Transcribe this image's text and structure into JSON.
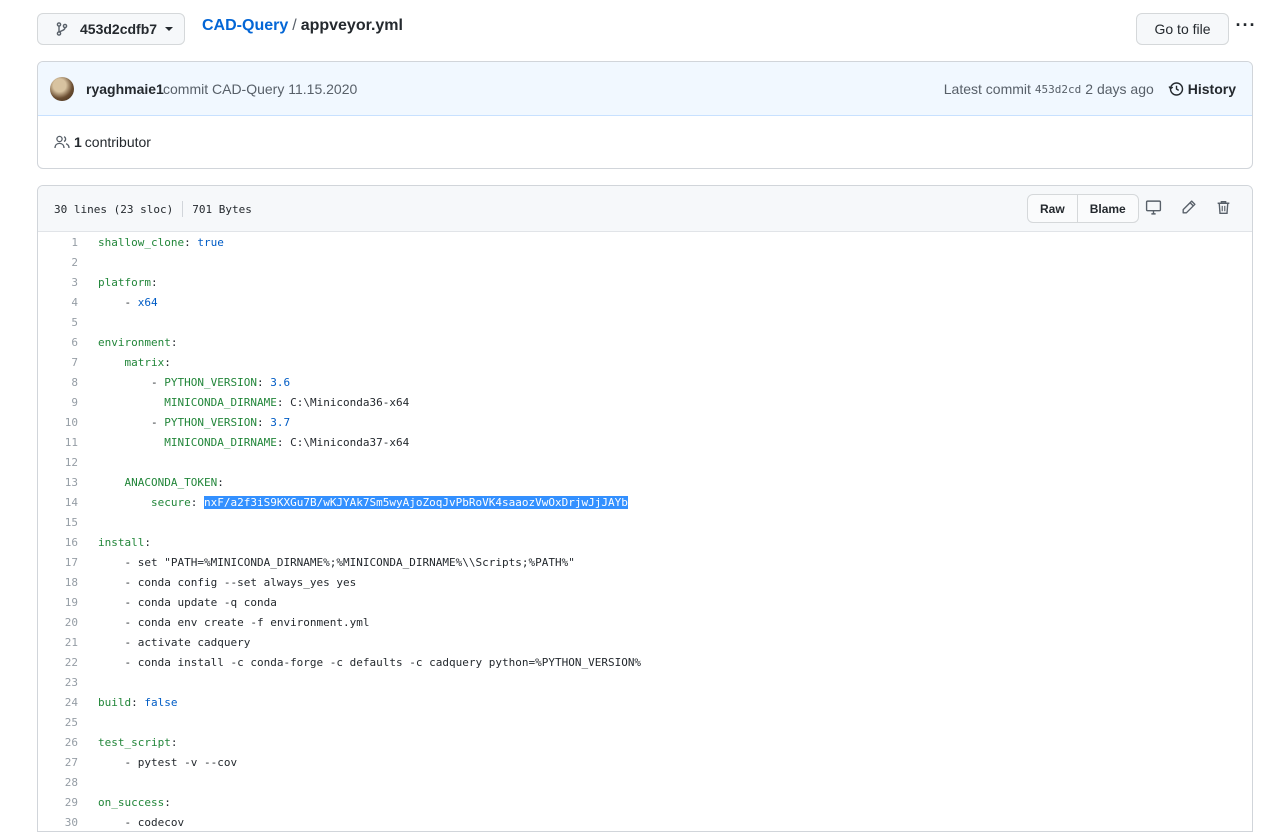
{
  "topbar": {
    "branch": "453d2cdfb7",
    "repo": "CAD-Query",
    "separator": "/",
    "file": "appveyor.yml",
    "go_to_file": "Go to file",
    "more": "···"
  },
  "commit": {
    "author": "ryaghmaie1",
    "message": "commit CAD-Query 11.15.2020",
    "latest_label": "Latest commit",
    "sha": "453d2cd",
    "age": "2 days ago",
    "history": "History"
  },
  "contributors": {
    "count": "1",
    "label": "contributor"
  },
  "file": {
    "lines_info": "30 lines (23 sloc)",
    "size": "701 Bytes",
    "raw": "Raw",
    "blame": "Blame"
  },
  "colors": {
    "link": "#0366d6",
    "key": "#22863a",
    "value": "#005cc5",
    "highlight": "#3390ff"
  },
  "code_lines": [
    {
      "n": "1",
      "indent": "",
      "key": "shallow_clone",
      "sep": ": ",
      "val": "true",
      "plain": "",
      "hl": ""
    },
    {
      "n": "2",
      "indent": "",
      "key": "",
      "sep": "",
      "val": "",
      "plain": "",
      "hl": ""
    },
    {
      "n": "3",
      "indent": "",
      "key": "platform",
      "sep": ":",
      "val": "",
      "plain": "",
      "hl": ""
    },
    {
      "n": "4",
      "indent": "    ",
      "key": "",
      "sep": "",
      "val": "x64",
      "plain": "- ",
      "hl": "",
      "order": "plain-first"
    },
    {
      "n": "5",
      "indent": "",
      "key": "",
      "sep": "",
      "val": "",
      "plain": "",
      "hl": ""
    },
    {
      "n": "6",
      "indent": "",
      "key": "environment",
      "sep": ":",
      "val": "",
      "plain": "",
      "hl": ""
    },
    {
      "n": "7",
      "indent": "    ",
      "key": "matrix",
      "sep": ":",
      "val": "",
      "plain": "",
      "hl": ""
    },
    {
      "n": "8",
      "indent": "        - ",
      "key": "PYTHON_VERSION",
      "sep": ": ",
      "val": "3.6",
      "plain": "",
      "hl": ""
    },
    {
      "n": "9",
      "indent": "          ",
      "key": "MINICONDA_DIRNAME",
      "sep": ": ",
      "val": "",
      "plain": "C:\\Miniconda36-x64",
      "hl": ""
    },
    {
      "n": "10",
      "indent": "        - ",
      "key": "PYTHON_VERSION",
      "sep": ": ",
      "val": "3.7",
      "plain": "",
      "hl": ""
    },
    {
      "n": "11",
      "indent": "          ",
      "key": "MINICONDA_DIRNAME",
      "sep": ": ",
      "val": "",
      "plain": "C:\\Miniconda37-x64",
      "hl": ""
    },
    {
      "n": "12",
      "indent": "",
      "key": "",
      "sep": "",
      "val": "",
      "plain": "",
      "hl": ""
    },
    {
      "n": "13",
      "indent": "    ",
      "key": "ANACONDA_TOKEN",
      "sep": ":",
      "val": "",
      "plain": "",
      "hl": ""
    },
    {
      "n": "14",
      "indent": "        ",
      "key": "secure",
      "sep": ": ",
      "val": "",
      "plain": "",
      "hl": "nxF/a2f3iS9KXGu7B/wKJYAk7Sm5wyAjoZoqJvPbRoVK4saaozVwOxDrjwJjJAYb"
    },
    {
      "n": "15",
      "indent": "",
      "key": "",
      "sep": "",
      "val": "",
      "plain": "",
      "hl": ""
    },
    {
      "n": "16",
      "indent": "",
      "key": "install",
      "sep": ":",
      "val": "",
      "plain": "",
      "hl": ""
    },
    {
      "n": "17",
      "indent": "    ",
      "key": "",
      "sep": "",
      "val": "",
      "plain": "- set \"PATH=%MINICONDA_DIRNAME%;%MINICONDA_DIRNAME%\\\\Scripts;%PATH%\"",
      "hl": ""
    },
    {
      "n": "18",
      "indent": "    ",
      "key": "",
      "sep": "",
      "val": "",
      "plain": "- conda config --set always_yes yes",
      "hl": ""
    },
    {
      "n": "19",
      "indent": "    ",
      "key": "",
      "sep": "",
      "val": "",
      "plain": "- conda update -q conda",
      "hl": ""
    },
    {
      "n": "20",
      "indent": "    ",
      "key": "",
      "sep": "",
      "val": "",
      "plain": "- conda env create -f environment.yml",
      "hl": ""
    },
    {
      "n": "21",
      "indent": "    ",
      "key": "",
      "sep": "",
      "val": "",
      "plain": "- activate cadquery",
      "hl": ""
    },
    {
      "n": "22",
      "indent": "    ",
      "key": "",
      "sep": "",
      "val": "",
      "plain": "- conda install -c conda-forge -c defaults -c cadquery python=%PYTHON_VERSION%",
      "hl": ""
    },
    {
      "n": "23",
      "indent": "",
      "key": "",
      "sep": "",
      "val": "",
      "plain": "",
      "hl": ""
    },
    {
      "n": "24",
      "indent": "",
      "key": "build",
      "sep": ": ",
      "val": "false",
      "plain": "",
      "hl": ""
    },
    {
      "n": "25",
      "indent": "",
      "key": "",
      "sep": "",
      "val": "",
      "plain": "",
      "hl": ""
    },
    {
      "n": "26",
      "indent": "",
      "key": "test_script",
      "sep": ":",
      "val": "",
      "plain": "",
      "hl": ""
    },
    {
      "n": "27",
      "indent": "    ",
      "key": "",
      "sep": "",
      "val": "",
      "plain": "- pytest -v --cov",
      "hl": ""
    },
    {
      "n": "28",
      "indent": "",
      "key": "",
      "sep": "",
      "val": "",
      "plain": "",
      "hl": ""
    },
    {
      "n": "29",
      "indent": "",
      "key": "on_success",
      "sep": ":",
      "val": "",
      "plain": "",
      "hl": ""
    },
    {
      "n": "30",
      "indent": "    ",
      "key": "",
      "sep": "",
      "val": "",
      "plain": "- codecov",
      "hl": ""
    }
  ]
}
